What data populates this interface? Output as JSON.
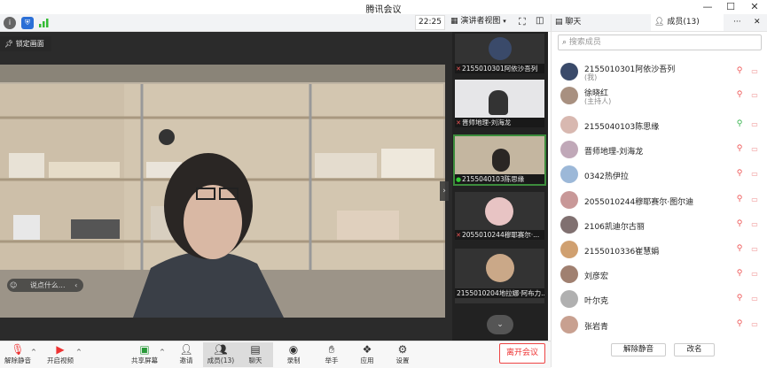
{
  "window": {
    "title": "腾讯会议"
  },
  "toolbar": {
    "time": "22:25",
    "view_label": "演讲者视图"
  },
  "stage": {
    "lock_label": "锁定画面",
    "chat_placeholder": "说点什么..."
  },
  "thumbnails": [
    {
      "name": "2155010301阿依沙吾列",
      "mic": "muted"
    },
    {
      "name": "晋师地理-刘海龙",
      "mic": "muted"
    },
    {
      "name": "2155040103陈思缘",
      "mic": "on"
    },
    {
      "name": "2055010244穆耶赛尔·...",
      "mic": "muted"
    },
    {
      "name": "2155010204地拉娜·阿布力...",
      "mic": "none"
    }
  ],
  "panel": {
    "tab_chat": "聊天",
    "tab_members": "成员(13)",
    "search_placeholder": "搜索成员",
    "unmute_all": "解除静音",
    "rename": "改名"
  },
  "members": [
    {
      "name": "2155010301阿依沙吾列",
      "sub": "(我)",
      "mic": "muted",
      "avatar_color": "#3a4a6a"
    },
    {
      "name": "徐晓红",
      "sub": "(主持人)",
      "mic": "muted",
      "avatar_color": "#a89080"
    },
    {
      "name": "2155040103陈思缘",
      "sub": "",
      "mic": "on",
      "avatar_color": "#d8b8b0"
    },
    {
      "name": "晋师地理-刘海龙",
      "sub": "",
      "mic": "muted",
      "avatar_color": "#c0a8b8"
    },
    {
      "name": "0342热伊拉",
      "sub": "",
      "mic": "muted",
      "avatar_color": "#9cb8d8"
    },
    {
      "name": "2055010244穆耶赛尔·图尔迪",
      "sub": "",
      "mic": "muted",
      "avatar_color": "#c89898"
    },
    {
      "name": "2106凯迪尔古丽",
      "sub": "",
      "mic": "muted",
      "avatar_color": "#807070"
    },
    {
      "name": "2155010336崔慧娟",
      "sub": "",
      "mic": "muted",
      "avatar_color": "#d0a070"
    },
    {
      "name": "刘彦宏",
      "sub": "",
      "mic": "muted",
      "avatar_color": "#a08070"
    },
    {
      "name": "叶尔克",
      "sub": "",
      "mic": "muted",
      "avatar_color": "#b0b0b0"
    },
    {
      "name": "张岩青",
      "sub": "",
      "mic": "muted",
      "avatar_color": "#c8a090"
    }
  ],
  "bottombar": {
    "unmute": "解除静音",
    "start_video": "开启视频",
    "share_screen": "共享屏幕",
    "invite": "邀请",
    "members": "成员(13)",
    "chat": "聊天",
    "record": "录制",
    "raise_hand": "举手",
    "apps": "应用",
    "settings": "设置",
    "leave": "离开会议"
  },
  "colors": {
    "accent": "#2b6fd6",
    "danger": "#e33",
    "mic_on": "#33b34a"
  }
}
